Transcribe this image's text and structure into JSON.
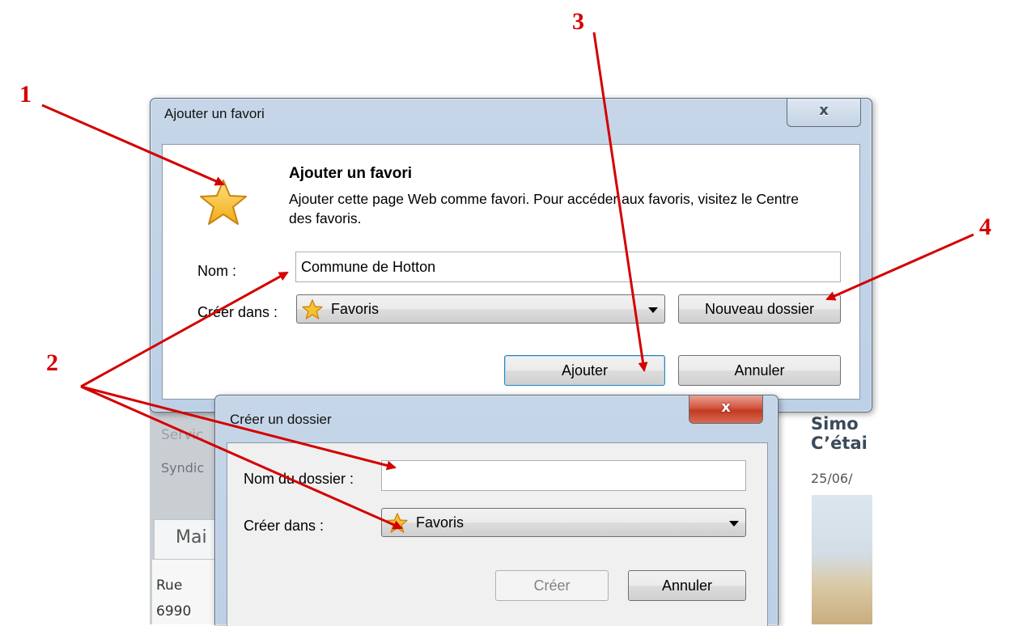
{
  "background_page": {
    "left_items": [
      "Servic",
      "Syndic"
    ],
    "left_heading": "Mai",
    "left_lines": [
      "Rue",
      "6990"
    ],
    "right_lines": [
      "Simo",
      "C’étai",
      "25/06/"
    ]
  },
  "dialog_add_favorite": {
    "title": "Ajouter un favori",
    "close_glyph": "x",
    "heading": "Ajouter un favori",
    "description": "Ajouter cette page Web comme favori. Pour accéder aux favoris, visitez le Centre des favoris.",
    "name_label": "Nom :",
    "name_value": "Commune de Hotton",
    "create_in_label": "Créer dans :",
    "create_in_value": "Favoris",
    "new_folder_button": "Nouveau dossier",
    "add_button": "Ajouter",
    "cancel_button": "Annuler"
  },
  "dialog_create_folder": {
    "title": "Créer un dossier",
    "close_glyph": "x",
    "folder_name_label": "Nom du dossier :",
    "folder_name_value": "",
    "create_in_label": "Créer dans :",
    "create_in_value": "Favoris",
    "create_button": "Créer",
    "cancel_button": "Annuler"
  },
  "annotations": {
    "labels": [
      "1",
      "2",
      "3",
      "4"
    ],
    "color": "#d40000"
  },
  "colors": {
    "frame": "#bcd0e6",
    "close_red": "#c23b22",
    "star": "#f5c518"
  }
}
